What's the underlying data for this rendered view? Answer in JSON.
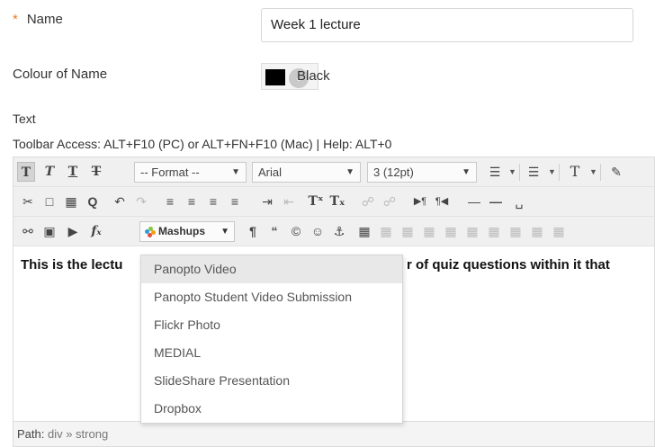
{
  "form": {
    "name_required_marker": "*",
    "name_label": "Name",
    "name_value": "Week 1 lecture",
    "colour_label": "Colour of Name",
    "colour_value": "Black",
    "colour_hex": "#000000",
    "text_label": "Text",
    "toolbar_access": "Toolbar Access: ALT+F10 (PC) or ALT+FN+F10 (Mac) | Help: ALT+0"
  },
  "toolbar": {
    "format_label": "-- Format --",
    "font_label": "Arial",
    "size_label": "3 (12pt)",
    "mashups_label": "Mashups"
  },
  "editor": {
    "content_left": "This is the lectu",
    "content_right": "r of quiz questions within it that",
    "path_label": "Path:",
    "path_value": "div » strong"
  },
  "mashups_menu": {
    "items": [
      "Panopto Video",
      "Panopto Student Video Submission",
      "Flickr Photo",
      "MEDIAL",
      "SlideShare Presentation",
      "Dropbox"
    ],
    "highlighted_index": 0
  },
  "colors": {
    "required": "#e67e22",
    "toolbar_bg": "#f0f0f0",
    "menu_highlight": "#e8e8e8"
  }
}
